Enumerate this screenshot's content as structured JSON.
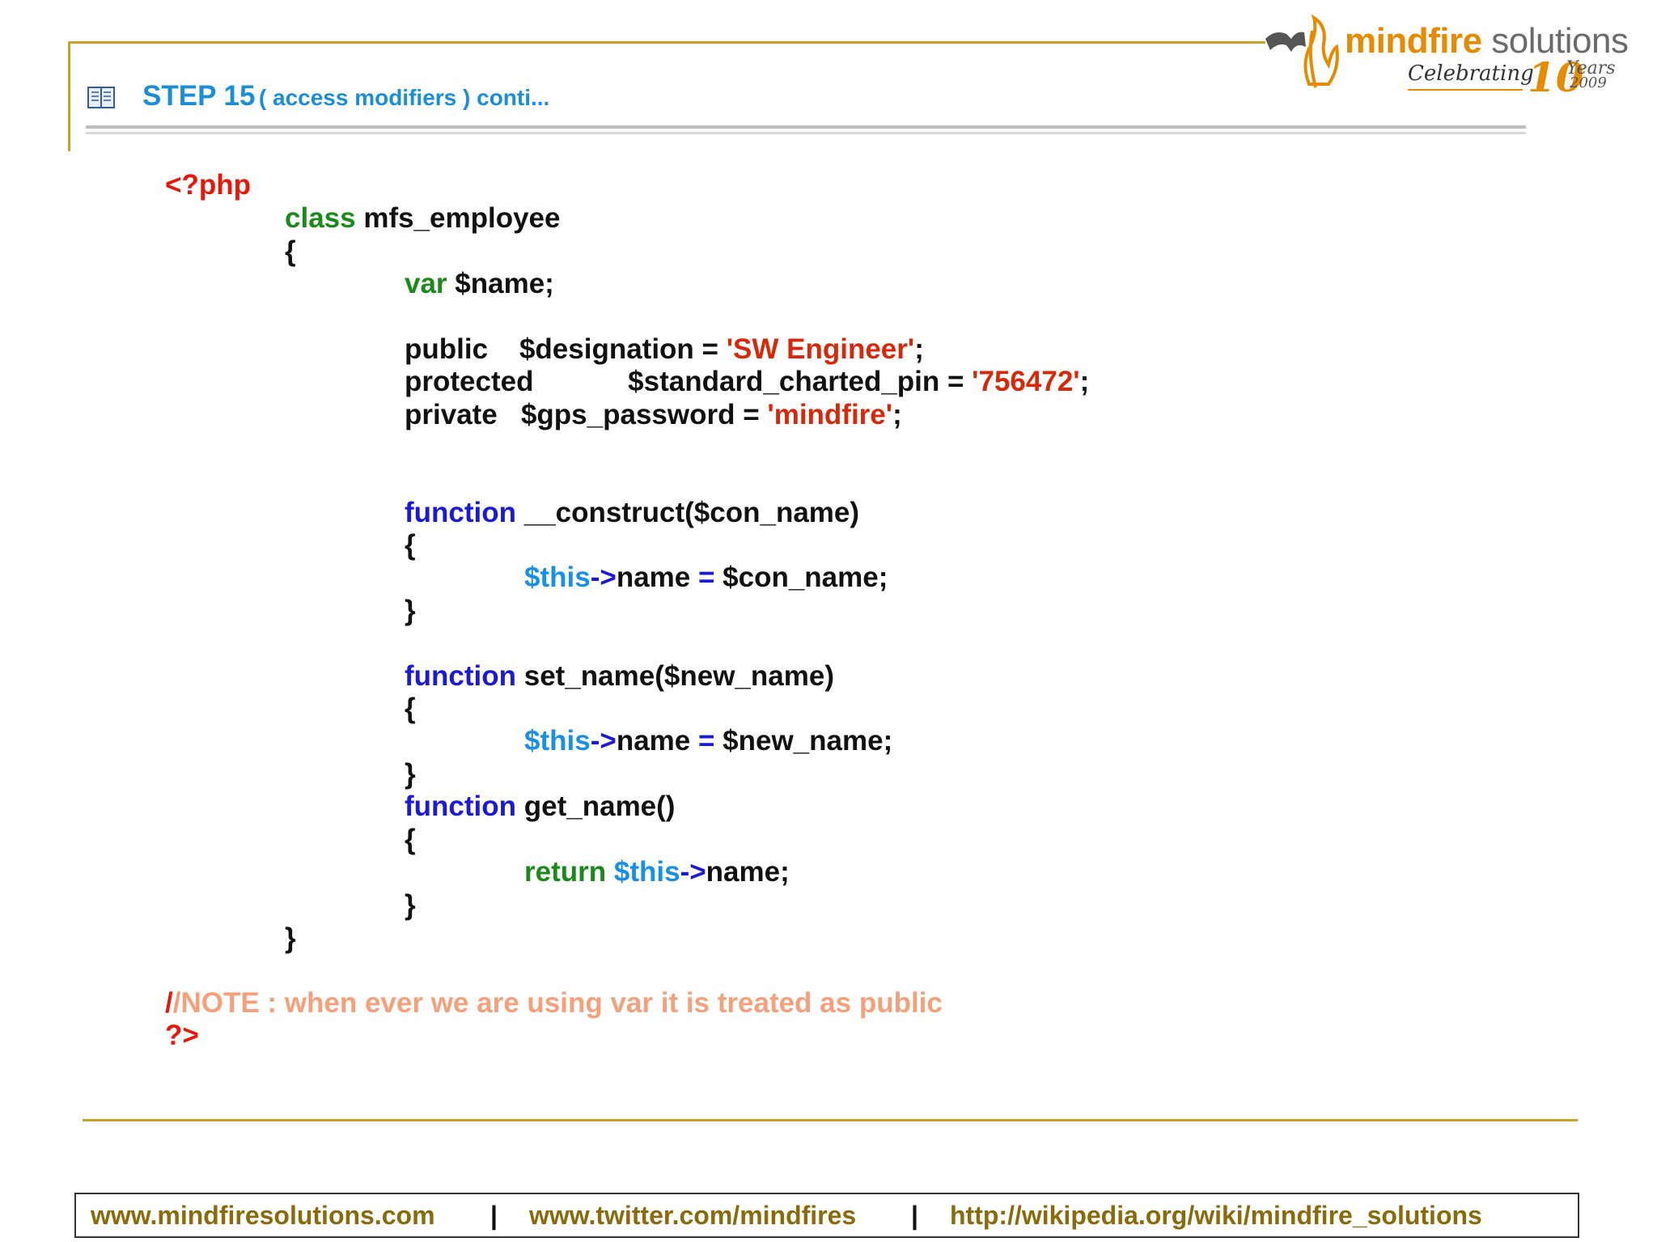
{
  "header": {
    "step": "STEP 15",
    "subtitle": "( access modifiers  ) conti..."
  },
  "logo": {
    "name_bold": "mindfire",
    "name_rest": " solutions",
    "celebrating": "Celebrating",
    "ten": "10",
    "years": "Years",
    "year": "2009"
  },
  "code": {
    "php_open": "<?php",
    "class_kw": "class",
    "class_name": " mfs_employee",
    "brace_open": "{",
    "brace_close": "}",
    "var_kw": "var",
    "var_name": " $name;",
    "public_kw": "public    $designation = ",
    "public_val": "'SW Engineer'",
    "semicolon": ";",
    "protected_kw": "protected            $standard_charted_pin = ",
    "protected_val": "'756472'",
    "private_kw": "private   $gps_password = ",
    "private_val": "'mindfire'",
    "function_kw": "function",
    "construct_sig": " __construct($con_name)",
    "this": "$this",
    "arrow": "->",
    "name_prop": "name ",
    "equals": "=",
    "construct_rhs": " $con_name;",
    "set_name_sig": " set_name($new_name)",
    "set_name_rhs": " $new_name;",
    "get_name_sig": " get_name()",
    "return_kw": "return",
    "return_tail": "name;",
    "note_slash": "/",
    "note_text": "/NOTE : when ever we are using var it is treated as public",
    "php_close": "?>"
  },
  "footer": {
    "link1": "www.mindfiresolutions.com",
    "link2": "www.twitter.com/mindfires",
    "link3": "http://wikipedia.org/wiki/mindfire_solutions",
    "separator": "|"
  },
  "colors": {
    "gold_rule": "#c9a227",
    "heading_blue": "#1a8fd8",
    "keyword_green": "#1a8a1a",
    "keyword_blue": "#1a1ad8",
    "string_red": "#d8280a",
    "note_salmon": "#f4a07a",
    "footer_link": "#8a6a0a",
    "logo_orange": "#e68a00"
  }
}
